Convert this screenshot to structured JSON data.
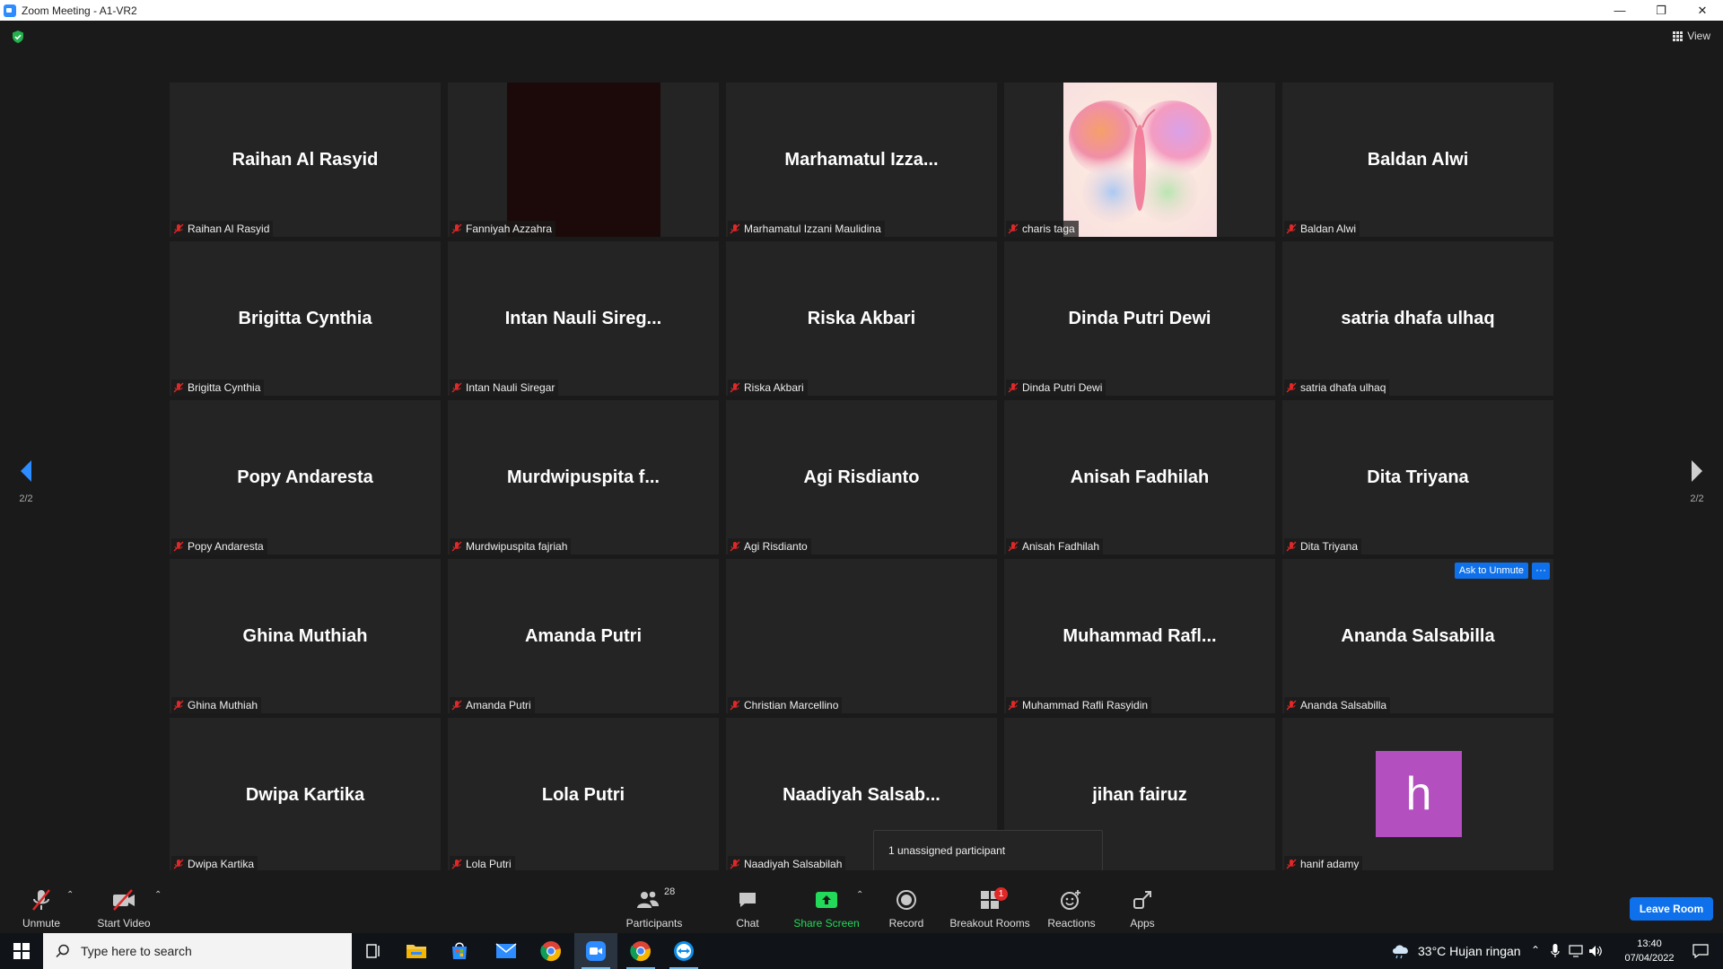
{
  "window": {
    "title": "Zoom Meeting - A1-VR2"
  },
  "view_label": "View",
  "pagination": {
    "left": "2/2",
    "right": "2/2"
  },
  "tiles": [
    {
      "display_name": "Raihan Al Rasyid",
      "label": "Raihan Al Rasyid",
      "video": ""
    },
    {
      "display_name": "",
      "label": "Fanniyah Azzahra",
      "video": "dark"
    },
    {
      "display_name": "Marhamatul  Izza...",
      "label": "Marhamatul Izzani Maulidina",
      "video": ""
    },
    {
      "display_name": "",
      "label": "charis taga",
      "video": "butterfly"
    },
    {
      "display_name": "Baldan Alwi",
      "label": "Baldan Alwi",
      "video": ""
    },
    {
      "display_name": "Brigitta Cynthia",
      "label": "Brigitta Cynthia",
      "video": ""
    },
    {
      "display_name": "Intan  Nauli  Sireg...",
      "label": "Intan Nauli Siregar",
      "video": ""
    },
    {
      "display_name": "Riska Akbari",
      "label": "Riska Akbari",
      "video": ""
    },
    {
      "display_name": "Dinda Putri Dewi",
      "label": "Dinda Putri Dewi",
      "video": ""
    },
    {
      "display_name": "satria dhafa ulhaq",
      "label": "satria dhafa ulhaq",
      "video": ""
    },
    {
      "display_name": "Popy Andaresta",
      "label": "Popy Andaresta",
      "video": ""
    },
    {
      "display_name": "Murdwipuspita  f...",
      "label": "Murdwipuspita fajriah",
      "video": ""
    },
    {
      "display_name": "Agi Risdianto",
      "label": "Agi Risdianto",
      "video": ""
    },
    {
      "display_name": "Anisah Fadhilah",
      "label": "Anisah Fadhilah",
      "video": ""
    },
    {
      "display_name": "Dita Triyana",
      "label": "Dita Triyana",
      "video": ""
    },
    {
      "display_name": "Ghina Muthiah",
      "label": "Ghina Muthiah",
      "video": ""
    },
    {
      "display_name": "Amanda Putri",
      "label": "Amanda Putri",
      "video": ""
    },
    {
      "display_name": "",
      "label": "Christian Marcellino",
      "video": ""
    },
    {
      "display_name": "Muhammad  Rafl...",
      "label": "Muhammad Rafli Rasyidin",
      "video": ""
    },
    {
      "display_name": "Ananda Salsabilla",
      "label": "Ananda Salsabilla",
      "video": "",
      "hover": true
    },
    {
      "display_name": "Dwipa Kartika",
      "label": "Dwipa Kartika",
      "video": ""
    },
    {
      "display_name": "Lola Putri",
      "label": "Lola Putri",
      "video": ""
    },
    {
      "display_name": "Naadiyah  Salsab...",
      "label": "Naadiyah Salsabilah",
      "video": ""
    },
    {
      "display_name": "jihan fairuz",
      "label": "",
      "video": ""
    },
    {
      "display_name": "",
      "label": "hanif adamy",
      "video": "avatar",
      "avatar_letter": "h"
    }
  ],
  "hover_actions": {
    "ask_to_unmute": "Ask to Unmute",
    "more": "···"
  },
  "unassigned_tooltip": "1 unassigned participant",
  "toolbar": {
    "unmute": "Unmute",
    "start_video": "Start Video",
    "participants": "Participants",
    "participant_count": "28",
    "chat": "Chat",
    "share_screen": "Share Screen",
    "record": "Record",
    "breakout_rooms": "Breakout Rooms",
    "breakout_badge": "1",
    "reactions": "Reactions",
    "apps": "Apps",
    "leave_room": "Leave Room"
  },
  "taskbar": {
    "search_placeholder": "Type here to search",
    "weather": "33°C  Hujan ringan",
    "time": "13:40",
    "date": "07/04/2022"
  },
  "colors": {
    "accent_blue": "#0e71eb",
    "share_green": "#23d959",
    "muted_red": "#e02828",
    "avatar_purple": "#b34fbf",
    "tile_bg": "#242424"
  }
}
